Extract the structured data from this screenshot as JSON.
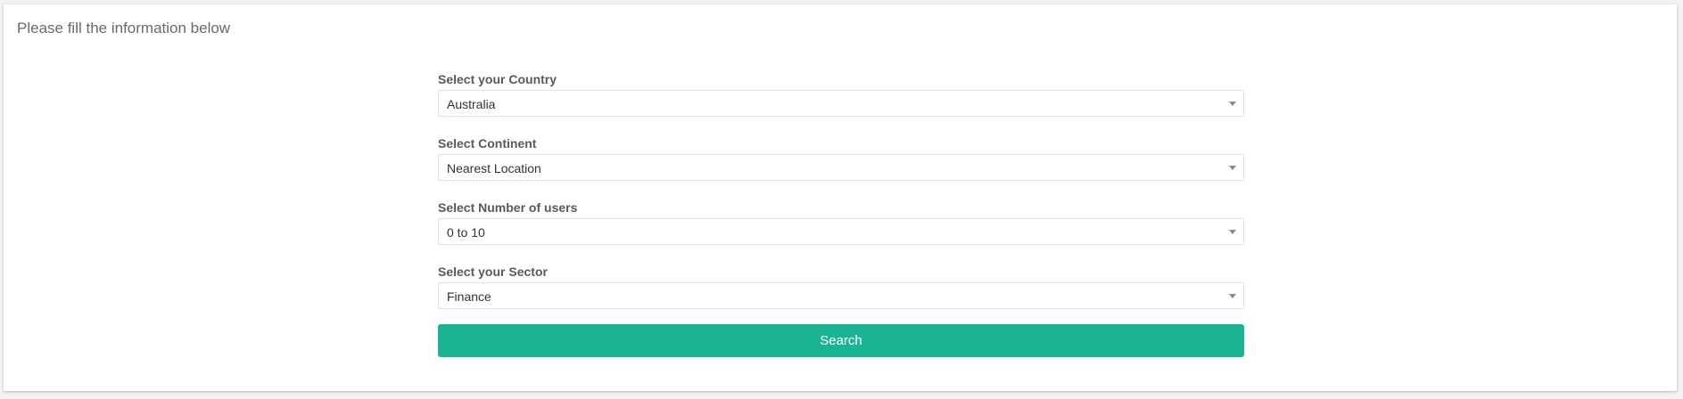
{
  "panel": {
    "title": "Please fill the information below"
  },
  "form": {
    "fields": [
      {
        "label": "Select your Country",
        "value": "Australia"
      },
      {
        "label": "Select Continent",
        "value": "Nearest Location"
      },
      {
        "label": "Select Number of users",
        "value": "0 to 10"
      },
      {
        "label": "Select your Sector",
        "value": "Finance"
      }
    ],
    "search_label": "Search"
  },
  "colors": {
    "accent": "#1ab394",
    "background": "#f3f3f4",
    "panel": "#ffffff",
    "text": "#676a6c"
  },
  "icons": {
    "select_arrow": "chevron-down-icon"
  }
}
